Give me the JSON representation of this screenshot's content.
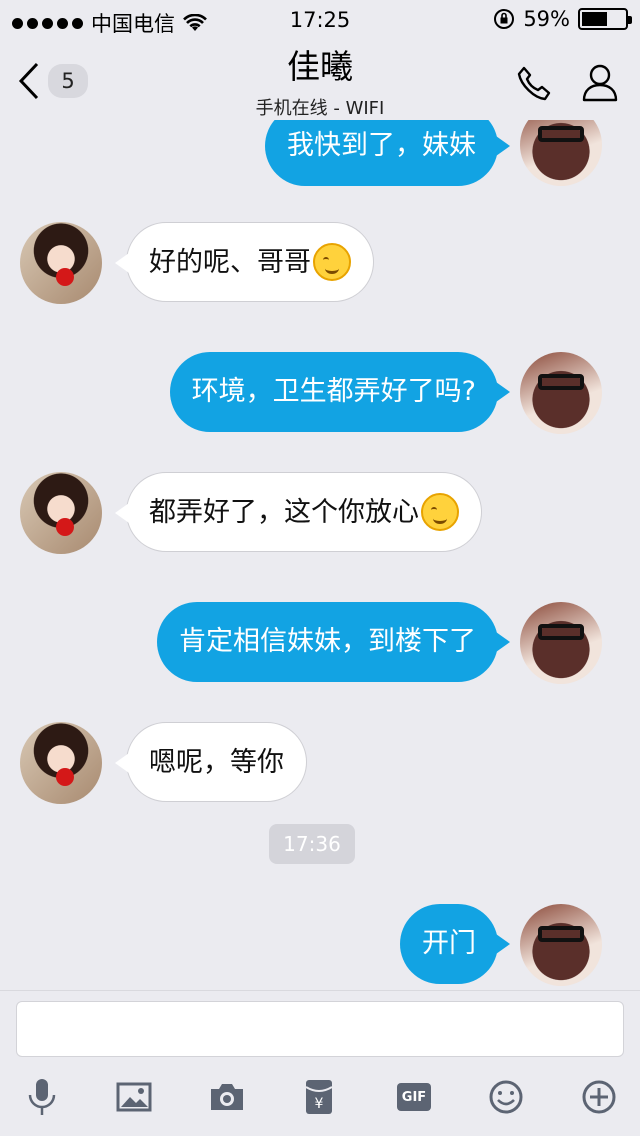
{
  "status_bar": {
    "carrier": "中国电信",
    "time": "17:25",
    "battery": "59%",
    "battery_level": 0.59
  },
  "nav": {
    "back_count": "5",
    "title": "佳曦",
    "subtitle": "手机在线 - WIFI"
  },
  "messages": [
    {
      "side": "out",
      "text": "我快到了，妹妹"
    },
    {
      "side": "in",
      "text": "好的呢、哥哥",
      "emoji": true
    },
    {
      "side": "out",
      "text": "环境，卫生都弄好了吗?"
    },
    {
      "side": "in",
      "text": "都弄好了，这个你放心",
      "emoji": true
    },
    {
      "side": "out",
      "text": "肯定相信妹妹，到楼下了"
    },
    {
      "side": "in",
      "text": "嗯呢，等你"
    },
    {
      "side": "time",
      "text": "17:36"
    },
    {
      "side": "out",
      "text": "开门"
    }
  ],
  "input": {
    "placeholder": ""
  },
  "toolbar": [
    "mic-icon",
    "image-icon",
    "camera-icon",
    "red-packet-icon",
    "gif-icon",
    "emoji-icon",
    "plus-icon"
  ],
  "toolbar_gif_label": "GIF",
  "colors": {
    "accent": "#12a3e3",
    "background": "#ebebf0"
  }
}
